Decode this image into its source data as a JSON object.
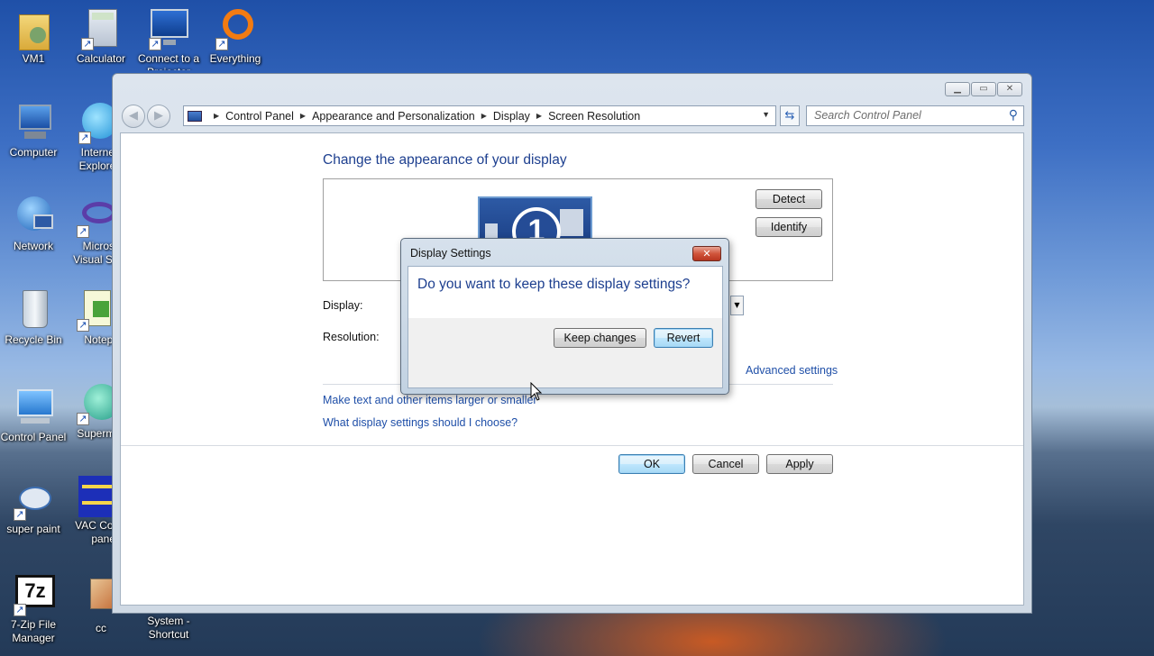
{
  "desktop_icons": [
    {
      "id": "vm1",
      "label": "VM1"
    },
    {
      "id": "calculator",
      "label": "Calculator"
    },
    {
      "id": "connect-projector",
      "label": "Connect to a Projector"
    },
    {
      "id": "everything",
      "label": "Everything"
    },
    {
      "id": "computer",
      "label": "Computer"
    },
    {
      "id": "internet-explorer",
      "label": "Internet Explorer"
    },
    {
      "id": "network",
      "label": "Network"
    },
    {
      "id": "visual-studio",
      "label": "Microsoft Visual Studio"
    },
    {
      "id": "recycle-bin",
      "label": "Recycle Bin"
    },
    {
      "id": "notepad",
      "label": "Notepad"
    },
    {
      "id": "control-panel",
      "label": "Control Panel"
    },
    {
      "id": "supermium",
      "label": "Supermium"
    },
    {
      "id": "super-paint",
      "label": "super paint"
    },
    {
      "id": "vac-control-panel",
      "label": "VAC Control panel"
    },
    {
      "id": "7zip",
      "label": "7-Zip File Manager"
    },
    {
      "id": "cc",
      "label": "cc"
    },
    {
      "id": "system-shortcut",
      "label": "System - Shortcut"
    }
  ],
  "window": {
    "breadcrumb": [
      "Control Panel",
      "Appearance and Personalization",
      "Display",
      "Screen Resolution"
    ],
    "search_placeholder": "Search Control Panel",
    "heading": "Change the appearance of your display",
    "monitor_number": "1",
    "detect_label": "Detect",
    "identify_label": "Identify",
    "display_label": "Display:",
    "resolution_label": "Resolution:",
    "advanced_settings": "Advanced settings",
    "link_text_larger": "Make text and other items larger or smaller",
    "link_which_settings": "What display settings should I choose?",
    "ok_label": "OK",
    "cancel_label": "Cancel",
    "apply_label": "Apply"
  },
  "dialog": {
    "title": "Display Settings",
    "question": "Do you want to keep these display settings?",
    "keep_label": "Keep changes",
    "revert_label": "Revert"
  }
}
